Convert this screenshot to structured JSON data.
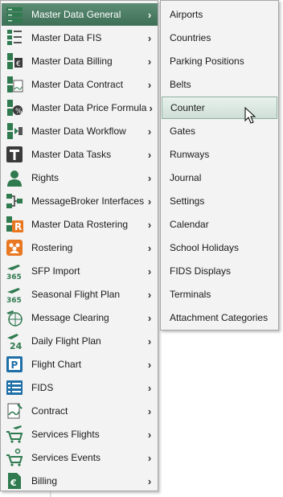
{
  "main_menu": {
    "items": [
      {
        "label": "Master Data General",
        "icon": "server-stack-icon",
        "active": true
      },
      {
        "label": "Master Data FIS",
        "icon": "data-list-icon"
      },
      {
        "label": "Master Data Billing",
        "icon": "billing-data-icon"
      },
      {
        "label": "Master Data Contract",
        "icon": "contract-data-icon"
      },
      {
        "label": "Master Data Price Formula",
        "icon": "price-formula-icon"
      },
      {
        "label": "Master Data Workflow",
        "icon": "workflow-data-icon"
      },
      {
        "label": "Master Data Tasks",
        "icon": "tasks-icon"
      },
      {
        "label": "Rights",
        "icon": "user-icon"
      },
      {
        "label": "MessageBroker Interfaces",
        "icon": "network-icon"
      },
      {
        "label": "Master Data Rostering",
        "icon": "rostering-data-icon"
      },
      {
        "label": "Rostering",
        "icon": "team-icon"
      },
      {
        "label": "SFP Import",
        "icon": "flight-365-import-icon"
      },
      {
        "label": "Seasonal Flight Plan",
        "icon": "flight-365-plan-icon"
      },
      {
        "label": "Message Clearing",
        "icon": "globe-plane-icon"
      },
      {
        "label": "Daily Flight Plan",
        "icon": "flight-24-icon"
      },
      {
        "label": "Flight Chart",
        "icon": "parking-chart-icon"
      },
      {
        "label": "FIDS",
        "icon": "fids-board-icon"
      },
      {
        "label": "Contract",
        "icon": "contract-signature-icon"
      },
      {
        "label": "Services Flights",
        "icon": "cart-plane-icon"
      },
      {
        "label": "Services Events",
        "icon": "cart-event-icon"
      },
      {
        "label": "Billing",
        "icon": "euro-document-icon"
      }
    ],
    "submenu_indicator": "›"
  },
  "sub_menu": {
    "items": [
      {
        "label": "Airports"
      },
      {
        "label": "Countries"
      },
      {
        "label": "Parking Positions"
      },
      {
        "label": "Belts"
      },
      {
        "label": "Counter",
        "hover": true
      },
      {
        "label": "Gates"
      },
      {
        "label": "Runways"
      },
      {
        "label": "Journal"
      },
      {
        "label": "Settings"
      },
      {
        "label": "Calendar"
      },
      {
        "label": "School Holidays"
      },
      {
        "label": "FIDS Displays"
      },
      {
        "label": "Terminals"
      },
      {
        "label": "Attachment Categories"
      }
    ]
  },
  "colors": {
    "accent_green": "#3d7a5c",
    "active_bg": "#4a7b63",
    "hover_border": "#8fb0a0",
    "menu_bg": "#f3f3f3"
  }
}
